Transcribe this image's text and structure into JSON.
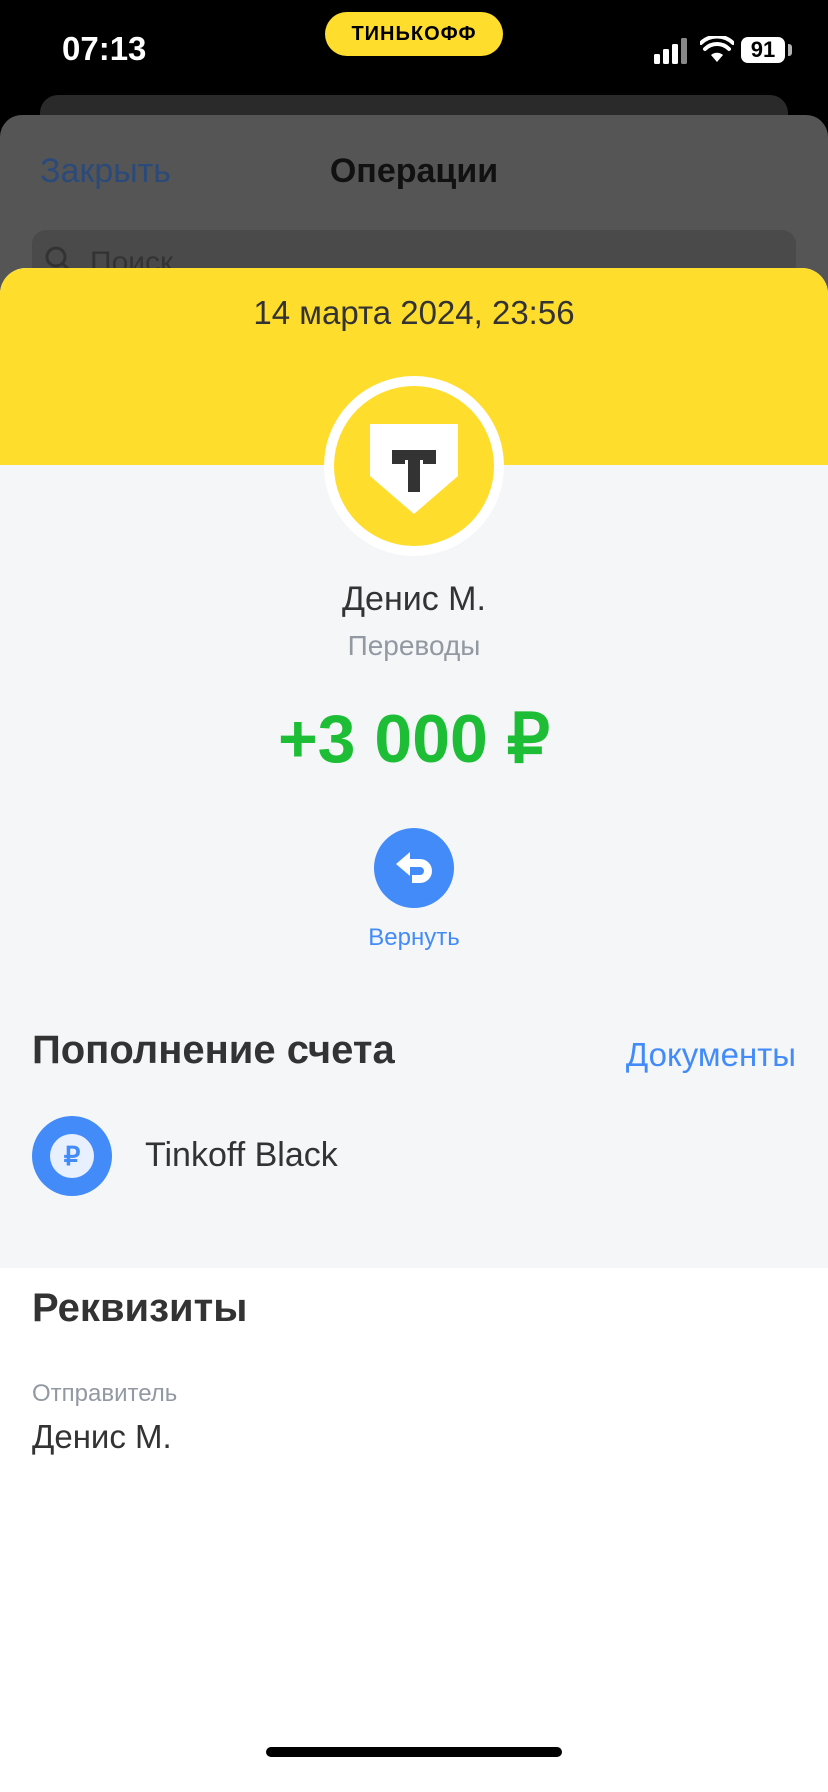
{
  "status_bar": {
    "time": "07:13",
    "app_pill": "ТИНЬКОФФ",
    "battery": "91"
  },
  "background_sheet": {
    "close": "Закрыть",
    "title": "Операции",
    "search_placeholder": "Поиск"
  },
  "operation": {
    "datetime": "14 марта 2024, 23:56",
    "counterparty": "Денис М.",
    "category": "Переводы",
    "amount": "+3 000 ₽",
    "return_label": "Вернуть"
  },
  "topup_section": {
    "title": "Пополнение счета",
    "documents_link": "Документы",
    "account_name": "Tinkoff Black",
    "account_icon": "₽"
  },
  "details_section": {
    "title": "Реквизиты",
    "sender_label": "Отправитель",
    "sender_value": "Денис М."
  },
  "colors": {
    "brand_yellow": "#FFDD2D",
    "accent_blue": "#428BF9",
    "income_green": "#1DBE35"
  }
}
